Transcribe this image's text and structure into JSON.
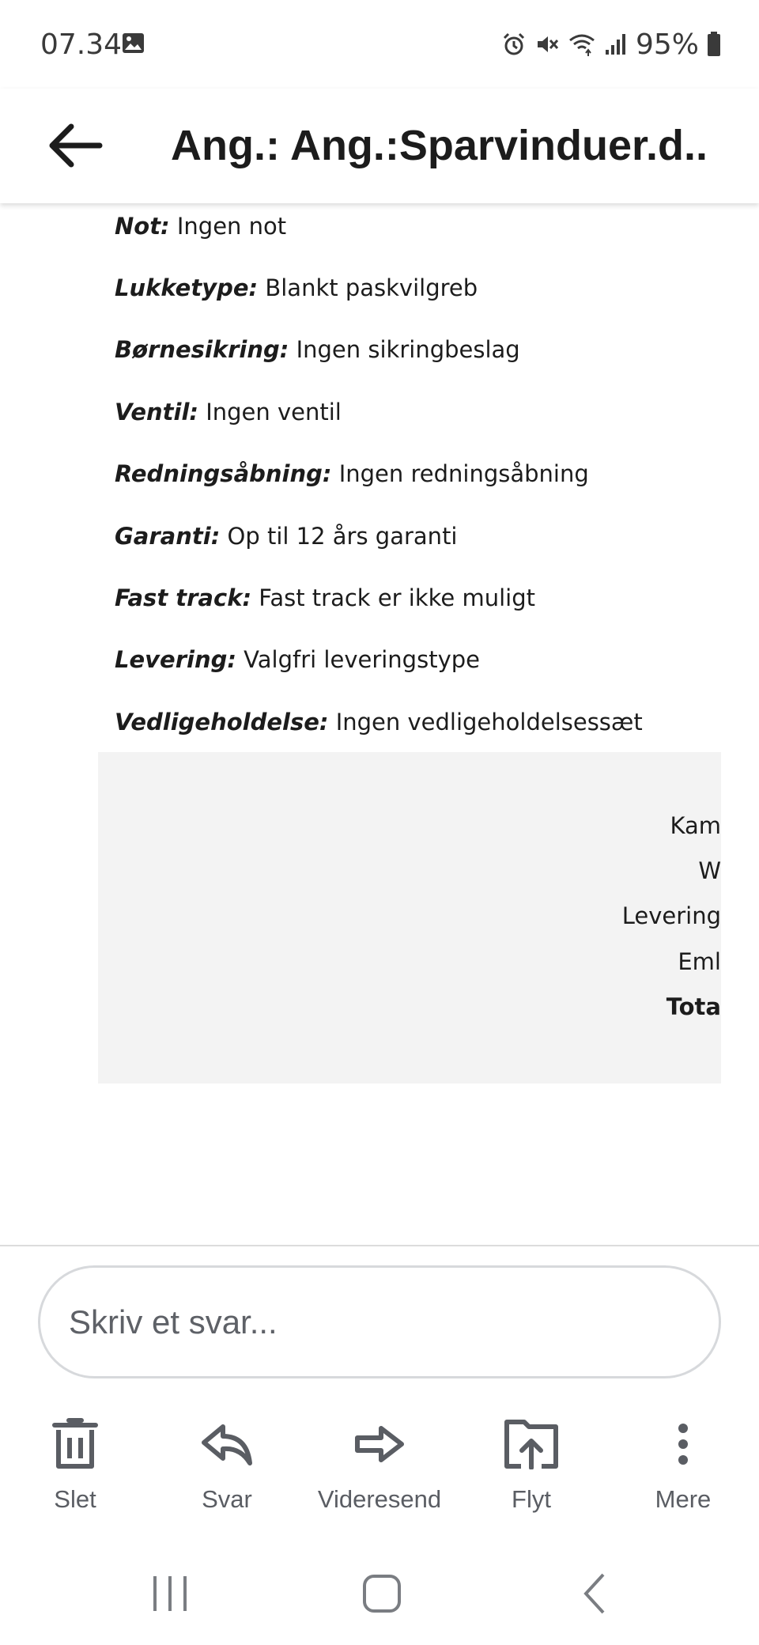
{
  "status_bar": {
    "time": "07.34",
    "battery": "95%",
    "icons": [
      "image-icon",
      "alarm-icon",
      "mute-icon",
      "wifi-icon",
      "signal-icon",
      "battery-icon"
    ]
  },
  "header": {
    "subject": "Ang.: Ang.:Sparvinduer.d..."
  },
  "specs": [
    {
      "label": "Not:",
      "value": " Ingen not"
    },
    {
      "label": "Lukketype:",
      "value": " Blankt paskvilgreb"
    },
    {
      "label": "Børnesikring:",
      "value": " Ingen sikringbeslag"
    },
    {
      "label": "Ventil:",
      "value": " Ingen ventil"
    },
    {
      "label": "Redningsåbning:",
      "value": " Ingen redningsåbning"
    },
    {
      "label": "Garanti:",
      "value": " Op til 12 års garanti"
    },
    {
      "label": "Fast track:",
      "value": " Fast track er ikke muligt"
    },
    {
      "label": "Levering:",
      "value": " Valgfri leveringstype"
    },
    {
      "label": "Vedligeholdelse:",
      "value": " Ingen vedligeholdelsessæt"
    }
  ],
  "totals": [
    "Kam",
    "W",
    "Levering",
    "Eml",
    "Tota"
  ],
  "reply": {
    "placeholder": "Skriv et svar..."
  },
  "actions": [
    {
      "label": "Slet",
      "icon": "trash-icon"
    },
    {
      "label": "Svar",
      "icon": "reply-icon"
    },
    {
      "label": "Videresend",
      "icon": "forward-icon"
    },
    {
      "label": "Flyt",
      "icon": "move-folder-icon"
    },
    {
      "label": "Mere",
      "icon": "more-vertical-icon"
    }
  ],
  "colors": {
    "text": "#1c1c1c",
    "muted": "#5a5d63",
    "totals_bg": "#f3f3f3",
    "input_border": "#d7d9dc"
  }
}
